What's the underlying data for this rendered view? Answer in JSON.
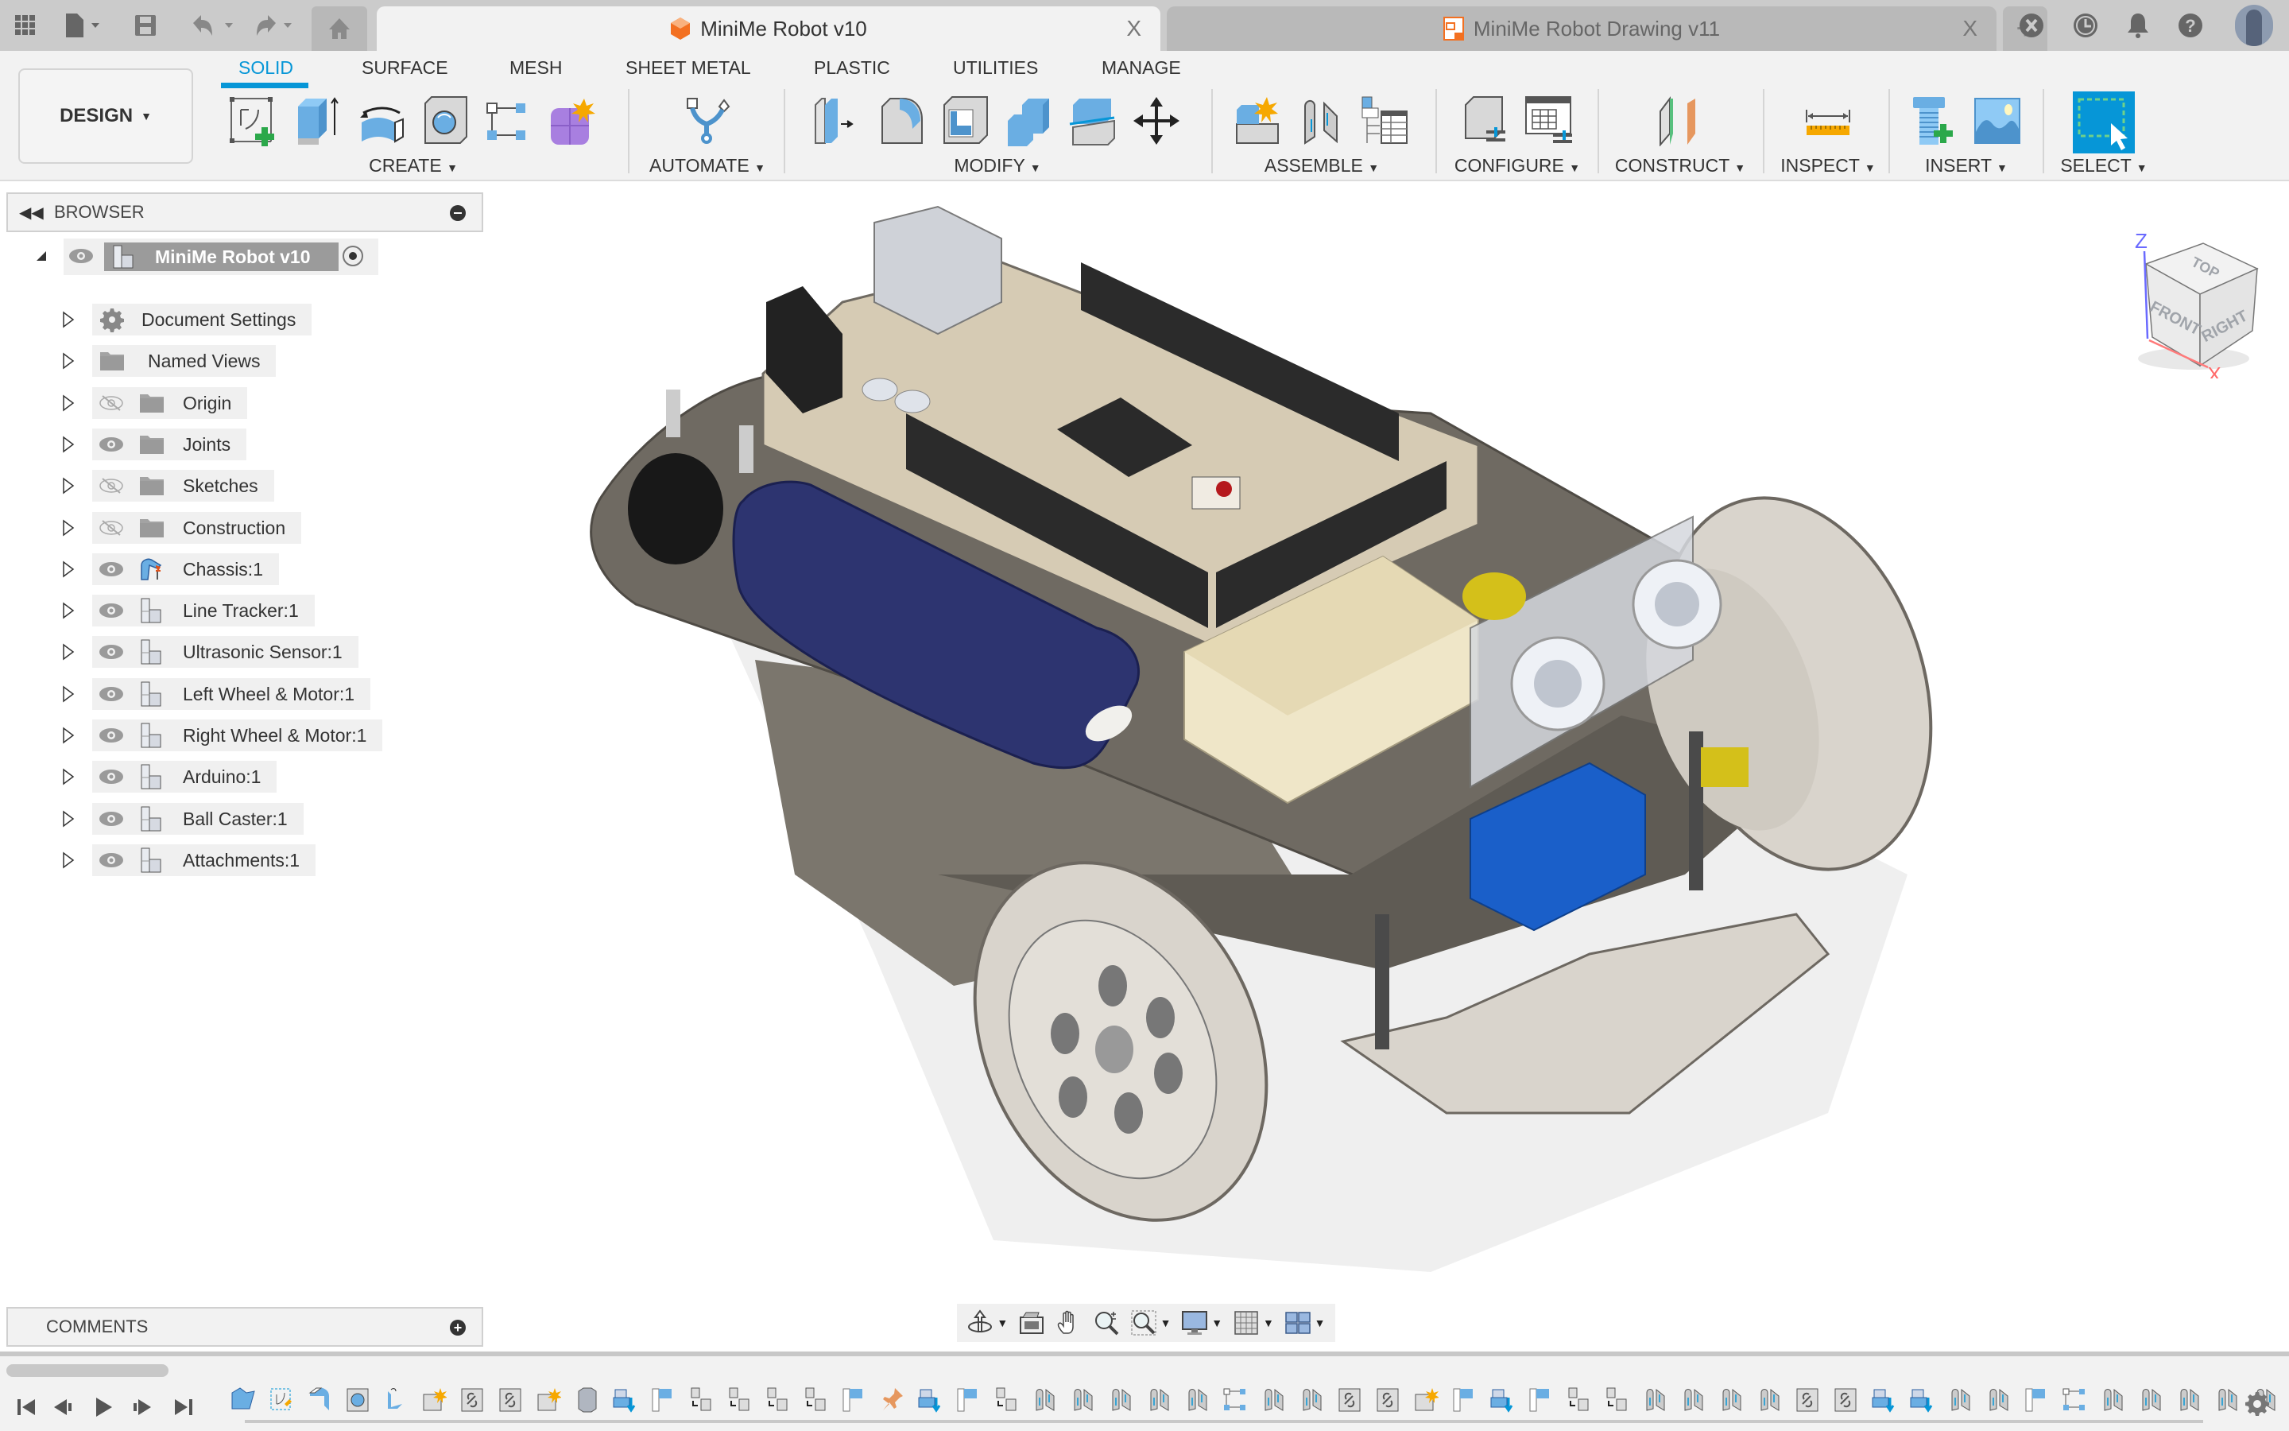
{
  "tabbar": {
    "icons": [
      "apps-grid-icon",
      "file-menu-icon",
      "save-icon",
      "undo-icon",
      "redo-icon",
      "home-icon"
    ],
    "tabs": [
      {
        "label": "MiniMe Robot v10",
        "active": true,
        "icon": "design-doc-icon",
        "close": "X"
      },
      {
        "label": "MiniMe Robot Drawing v11",
        "active": false,
        "icon": "drawing-doc-icon",
        "close": "X"
      }
    ],
    "new_tab": "+",
    "right_icons": [
      "extensions-icon",
      "job-status-icon",
      "notifications-icon",
      "help-icon",
      "user-avatar"
    ]
  },
  "ribbon": {
    "workspace": "DESIGN",
    "tabs": [
      "SOLID",
      "SURFACE",
      "MESH",
      "SHEET METAL",
      "PLASTIC",
      "UTILITIES",
      "MANAGE"
    ],
    "active_tab": "SOLID",
    "groups": [
      {
        "label": "CREATE",
        "tools": [
          "create-sketch",
          "extrude",
          "revolve",
          "hole",
          "pattern",
          "create-form"
        ]
      },
      {
        "label": "AUTOMATE",
        "tools": [
          "automated-modeling"
        ]
      },
      {
        "label": "MODIFY",
        "tools": [
          "press-pull",
          "fillet",
          "shell",
          "combine",
          "split-body",
          "move-copy"
        ]
      },
      {
        "label": "ASSEMBLE",
        "tools": [
          "new-component",
          "joint",
          "bill-of-materials"
        ]
      },
      {
        "label": "CONFIGURE",
        "tools": [
          "configure-design",
          "configuration-table"
        ]
      },
      {
        "label": "CONSTRUCT",
        "tools": [
          "offset-plane"
        ]
      },
      {
        "label": "INSPECT",
        "tools": [
          "measure"
        ]
      },
      {
        "label": "INSERT",
        "tools": [
          "insert-mcmaster",
          "insert-canvas"
        ]
      },
      {
        "label": "SELECT",
        "tools": [
          "window-select"
        ]
      }
    ]
  },
  "browser": {
    "title": "BROWSER",
    "root": {
      "label": "MiniMe Robot v10"
    },
    "items": [
      {
        "label": "Document Settings",
        "icon": "gear",
        "visible": null
      },
      {
        "label": "Named Views",
        "icon": "folder",
        "visible": null
      },
      {
        "label": "Origin",
        "icon": "folder",
        "visible": false
      },
      {
        "label": "Joints",
        "icon": "folder",
        "visible": true
      },
      {
        "label": "Sketches",
        "icon": "folder",
        "visible": false
      },
      {
        "label": "Construction",
        "icon": "folder",
        "visible": false
      },
      {
        "label": "Chassis:1",
        "icon": "grounded-component",
        "visible": true
      },
      {
        "label": "Line Tracker:1",
        "icon": "component",
        "visible": true
      },
      {
        "label": "Ultrasonic Sensor:1",
        "icon": "component",
        "visible": true
      },
      {
        "label": "Left Wheel & Motor:1",
        "icon": "component",
        "visible": true
      },
      {
        "label": "Right Wheel & Motor:1",
        "icon": "component",
        "visible": true
      },
      {
        "label": "Arduino:1",
        "icon": "component",
        "visible": true
      },
      {
        "label": "Ball Caster:1",
        "icon": "component",
        "visible": true
      },
      {
        "label": "Attachments:1",
        "icon": "component",
        "visible": true
      }
    ]
  },
  "comments": {
    "title": "COMMENTS"
  },
  "viewcube": {
    "top": "TOP",
    "front": "FRONT",
    "right": "RIGHT",
    "axis_z": "Z",
    "axis_x": "X"
  },
  "navbar": {
    "tools": [
      "orbit",
      "look-at",
      "pan",
      "zoom",
      "fit",
      "display-settings",
      "grid-snaps",
      "viewports"
    ]
  },
  "timeline": {
    "controls": [
      "go-to-start",
      "step-back",
      "play",
      "step-forward",
      "go-to-end"
    ]
  },
  "colors": {
    "accent": "#0696d7",
    "tabbar": "#cbcbcb",
    "ribbon": "#f2f2f2",
    "battery": "#2d3470",
    "arduino_board": "#d6cbb4",
    "chassis": "#6f6a62",
    "wheel": "#d9d4cc",
    "servo": "#1a5fc9"
  }
}
